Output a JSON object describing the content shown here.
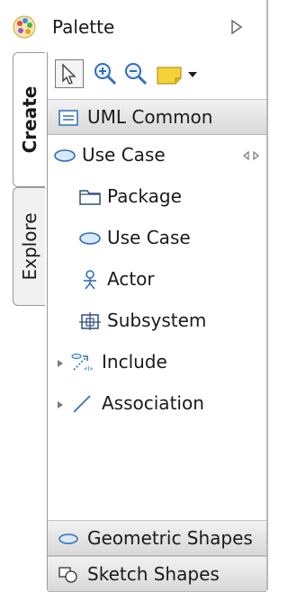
{
  "palette": {
    "title": "Palette",
    "collapse_icon": "chevron-right-icon"
  },
  "tabs": [
    {
      "label": "Create",
      "active": true
    },
    {
      "label": "Explore",
      "active": false
    }
  ],
  "toolbar": {
    "tools": [
      "select-arrow-icon",
      "zoom-in-icon",
      "zoom-out-icon",
      "note-icon",
      "dropdown-arrow-icon"
    ]
  },
  "drawers": {
    "uml_common": "UML Common",
    "use_case": "Use Case",
    "geometric_shapes": "Geometric Shapes",
    "sketch_shapes": "Sketch Shapes"
  },
  "items": [
    {
      "label": "Package",
      "icon": "package-icon"
    },
    {
      "label": "Use Case",
      "icon": "use-case-icon"
    },
    {
      "label": "Actor",
      "icon": "actor-icon"
    },
    {
      "label": "Subsystem",
      "icon": "subsystem-icon"
    },
    {
      "label": "Include",
      "icon": "include-icon",
      "expandable": true
    },
    {
      "label": "Association",
      "icon": "association-icon",
      "expandable": true
    }
  ],
  "colors": {
    "accent_blue": "#2f6fb8",
    "note_yellow": "#f5d23a"
  }
}
